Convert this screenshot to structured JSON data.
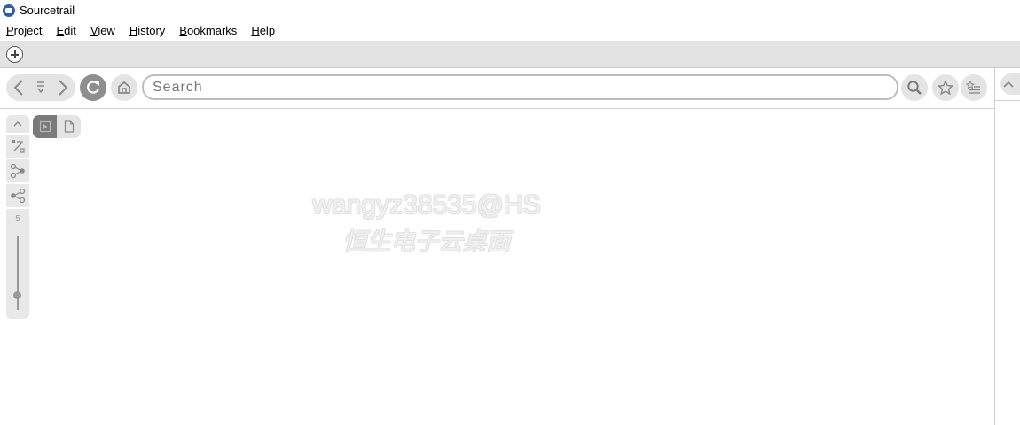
{
  "window": {
    "title": "Sourcetrail"
  },
  "menu": [
    {
      "first": "P",
      "rest": "roject"
    },
    {
      "first": "E",
      "rest": "dit"
    },
    {
      "first": "V",
      "rest": "iew"
    },
    {
      "first": "H",
      "rest": "istory"
    },
    {
      "first": "B",
      "rest": "ookmarks"
    },
    {
      "first": "H",
      "rest": "elp"
    }
  ],
  "search": {
    "placeholder": "Search",
    "value": ""
  },
  "graph_tools": {
    "zoom_level": "5"
  },
  "watermark": {
    "line1": "wangyz38535@HS",
    "line2": "恒生电子云桌面"
  },
  "colors": {
    "button_bg": "#e4e4e4",
    "icon": "#8a8a8a",
    "active_toggle": "#7a7a7a",
    "refresh_bg": "#8e8e8e"
  }
}
